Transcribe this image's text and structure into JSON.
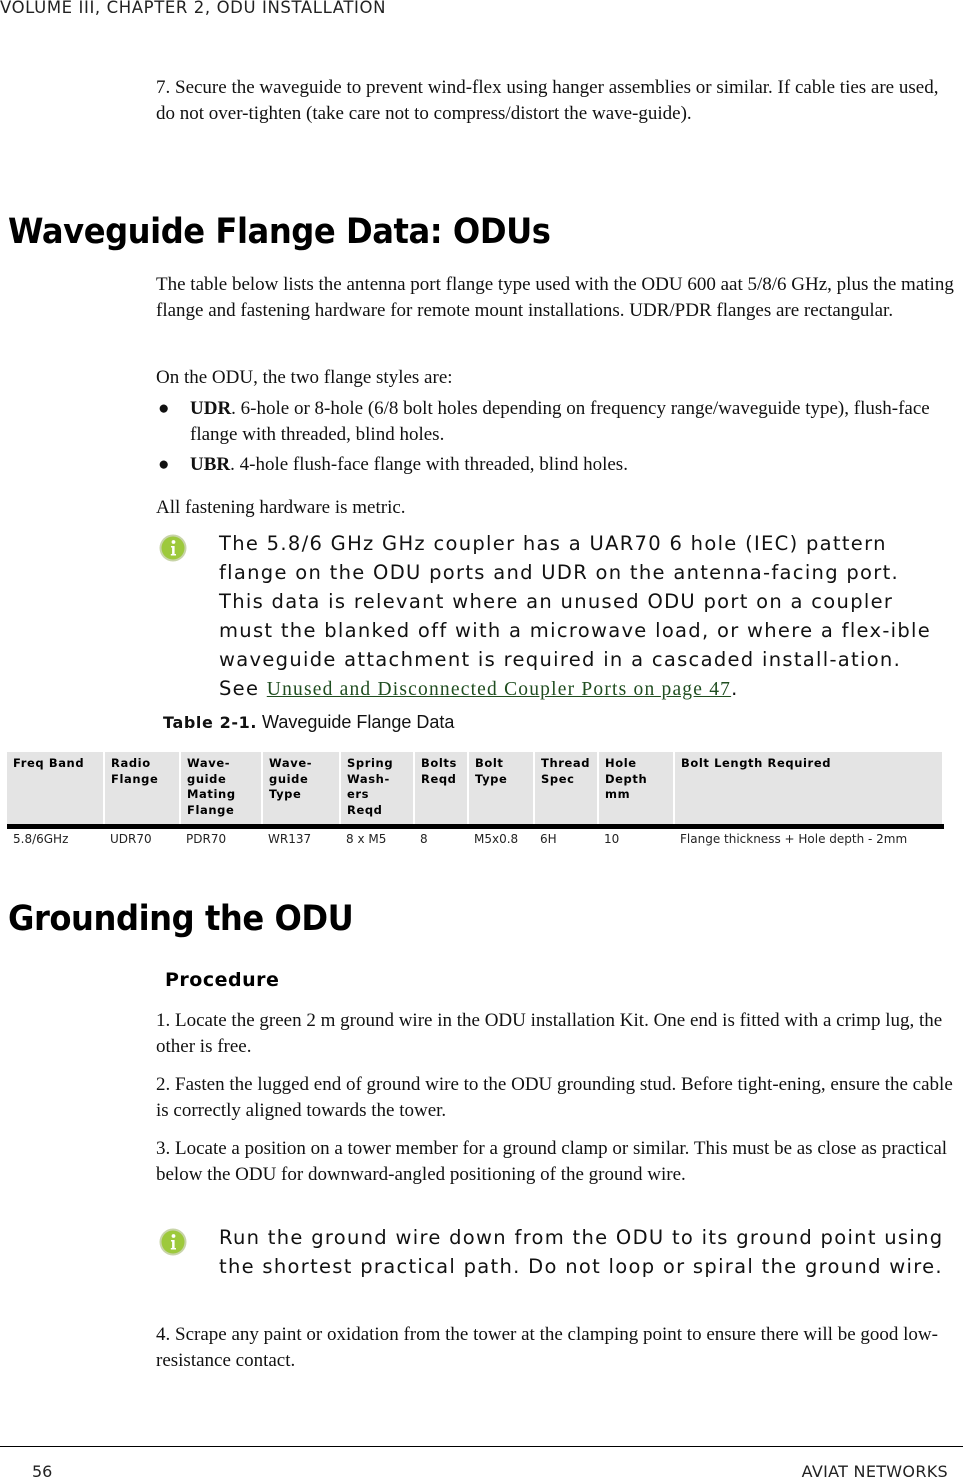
{
  "header": {
    "running_title": "VOLUME III, CHAPTER 2, ODU INSTALLATION"
  },
  "step7": "7. Secure the waveguide to prevent wind-flex using hanger assemblies or similar. If cable ties are used, do not over-tighten (take care not to compress/distort the wave-guide).",
  "section1": {
    "title": "Waveguide Flange Data: ODUs",
    "intro": "The table below lists the antenna port flange type used with the ODU 600 aat 5/8/6 GHz, plus the mating flange and fastening hardware for remote mount installations. UDR/PDR flanges are rectangular.",
    "styles_intro": "On the ODU, the two flange styles are:",
    "bullets": [
      {
        "bold": "UDR",
        "text": ". 6-hole or 8-hole (6/8 bolt holes depending on frequency range/waveguide type), flush-face flange with threaded, blind holes."
      },
      {
        "bold": "UBR",
        "text": ". 4-hole flush-face flange with threaded, blind holes."
      }
    ],
    "metric_note": "All fastening hardware is metric.",
    "info_note": {
      "icon": "info-icon",
      "text": "The 5.8/6 GHz GHz coupler has a UAR70 6 hole (IEC) pattern flange on the ODU ports and UDR on the antenna-facing port. This data is relevant where an unused ODU port on a coupler must the blanked off with a microwave load, or where a flex-ible waveguide attachment is required in a cascaded install-ation. See ",
      "link": "Unused and Disconnected Coupler Ports on page 47",
      "tail": "."
    },
    "table": {
      "caption_label": "Table 2-1.",
      "caption_title": " Waveguide Flange Data",
      "headers": [
        "Freq Band",
        "Radio Flange",
        "Wave-guide Mating Flange",
        "Wave-guide Type",
        "Spring Wash-ers Reqd",
        "Bolts Reqd",
        "Bolt Type",
        "Thread Spec",
        "Hole Depth mm",
        "Bolt Length Required"
      ],
      "rows": [
        [
          "5.8/6GHz",
          "UDR70",
          "PDR70",
          "WR137",
          "8 x M5",
          "8",
          "M5x0.8",
          "6H",
          "10",
          "Flange thickness + Hole depth - 2mm"
        ]
      ]
    }
  },
  "section2": {
    "title": "Grounding the ODU",
    "subtitle": "Procedure",
    "steps": [
      "1. Locate the green 2 m ground wire in the ODU installation Kit. One end is fitted with a crimp lug, the other is free.",
      "2. Fasten the lugged end of ground wire to the ODU grounding stud. Before tight-ening, ensure the cable is correctly aligned towards the tower.",
      "3. Locate a position on a tower member for a ground clamp or similar. This must be as close as practical below the ODU for downward-angled positioning of the ground wire.",
      "4. Scrape any paint or oxidation from the tower at the clamping point to ensure there will be good low-resistance contact."
    ],
    "info_note": {
      "icon": "info-icon",
      "text": "Run the ground wire down from the ODU to its ground point using the shortest practical path. Do not loop or spiral the ground wire."
    }
  },
  "footer": {
    "page_number": "56",
    "company": "AVIAT NETWORKS"
  },
  "colors": {
    "info_icon": "#9dc93c",
    "link": "#1f4d1f",
    "table_header_bg": "#e4e4e4"
  }
}
